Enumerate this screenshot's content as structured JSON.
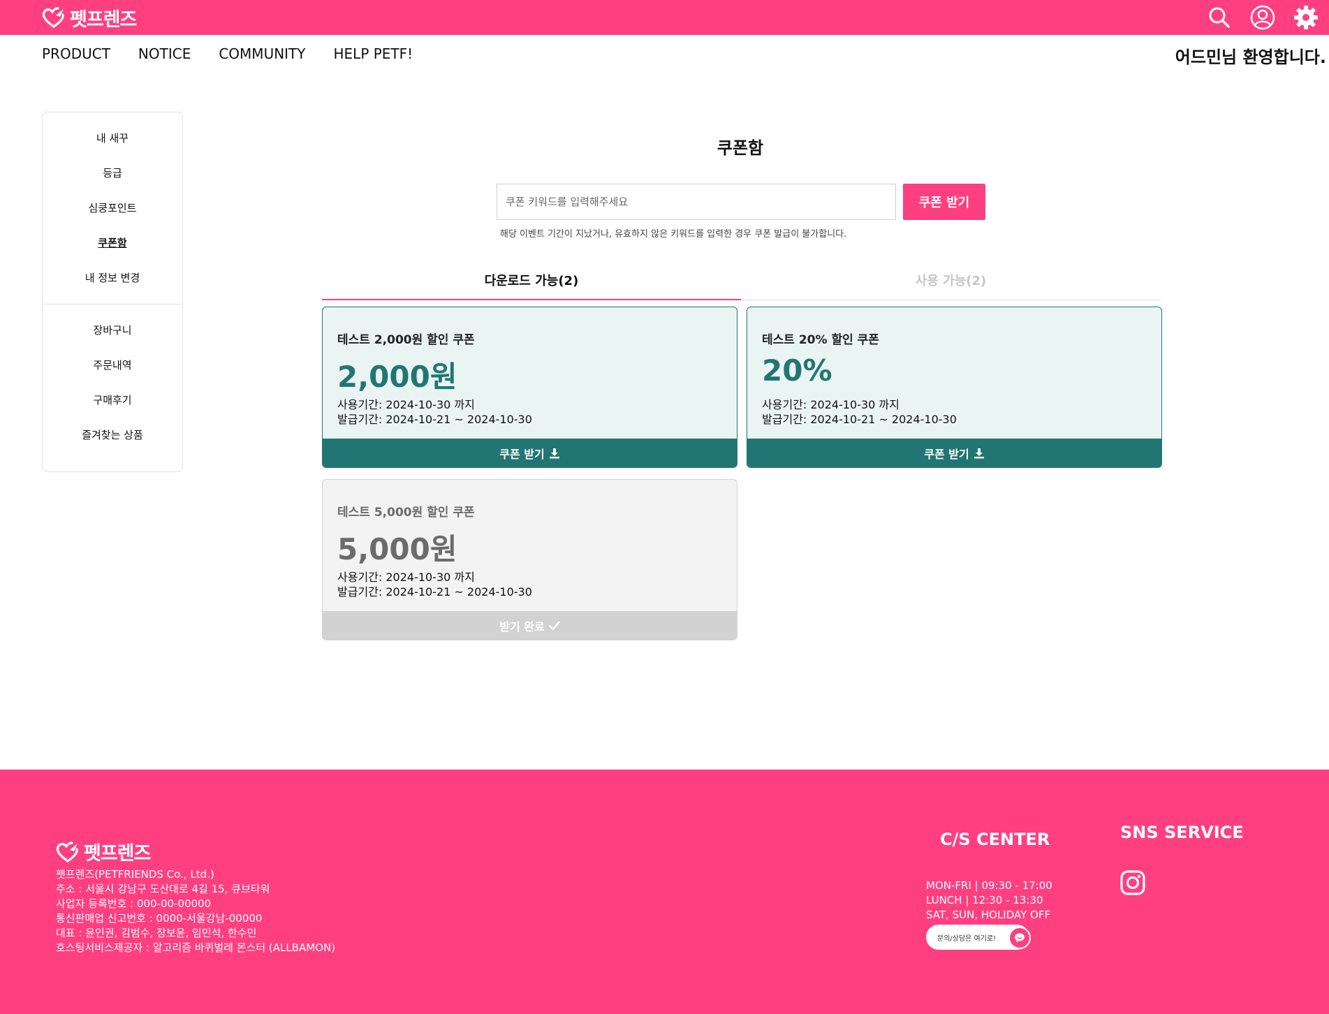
{
  "brand": {
    "logo_text": "펫프렌즈",
    "color": "#ff3f7f"
  },
  "header": {
    "icons": [
      "search-icon",
      "user-icon",
      "gear-icon"
    ]
  },
  "nav": {
    "items": [
      "PRODUCT",
      "NOTICE",
      "COMMUNITY",
      "HELP PETF!"
    ],
    "welcome": "어드민님 환영합니다."
  },
  "sidebar": {
    "group1": [
      "내 새꾸",
      "등급",
      "심쿵포인트",
      "쿠폰함",
      "내 정보 변경"
    ],
    "group2": [
      "장바구니",
      "주문내역",
      "구매후기",
      "즐겨찾는 상품"
    ],
    "active": "쿠폰함"
  },
  "main": {
    "title": "쿠폰함",
    "input_placeholder": "쿠폰 키워드를 입력해주세요",
    "get_button": "쿠폰 받기",
    "note": "해당 이벤트 기간이 지났거나, 유효하지 않은 키워드를 입력한 경우 쿠폰 발급이 불가합니다.",
    "tabs": [
      "다운로드 가능(2)",
      "사용 가능(2)"
    ],
    "coupons": [
      {
        "name": "테스트 2,000원 할인 쿠폰",
        "amount": "2,000원",
        "use_period": "사용기간: 2024-10-30 까지",
        "issue_period": "발급기간: 2024-10-21 ~ 2024-10-30",
        "action": "쿠폰 받기",
        "status": "available"
      },
      {
        "name": "테스트 20% 할인 쿠폰",
        "amount": "20%",
        "use_period": "사용기간: 2024-10-30 까지",
        "issue_period": "발급기간: 2024-10-21 ~ 2024-10-30",
        "action": "쿠폰 받기",
        "status": "available"
      },
      {
        "name": "테스트 5,000원 할인 쿠폰",
        "amount": "5,000원",
        "use_period": "사용기간: 2024-10-30 까지",
        "issue_period": "발급기간: 2024-10-21 ~ 2024-10-30",
        "action": "받기 완료",
        "status": "received"
      }
    ],
    "accent_teal": "#217673"
  },
  "footer": {
    "logo_text": "펫프렌즈",
    "info": [
      "펫프렌즈(PETFRIENDS Co., Ltd.)",
      "주소 : 서울시 강남구 도산대로 4길 15, 큐브타워",
      "사업자 등록번호 : 000-00-00000",
      "통신판매업 신고번호 : 0000-서울강남-00000",
      "대표 : 윤인권, 김범수, 장보윤, 임민석, 한수민",
      "호스팅서비스제공자 : 알고리즘 바퀴벌레 몬스터 (ALLBAMON)"
    ],
    "cs_title": "C/S CENTER",
    "cs_hours": [
      "MON-FRI | 09:30 - 17:00",
      "LUNCH | 12:30 - 13:30",
      "SAT, SUN, HOLIDAY OFF"
    ],
    "chat_label": "문의/상담은 여기로!",
    "sns_title": "SNS SERVICE"
  }
}
